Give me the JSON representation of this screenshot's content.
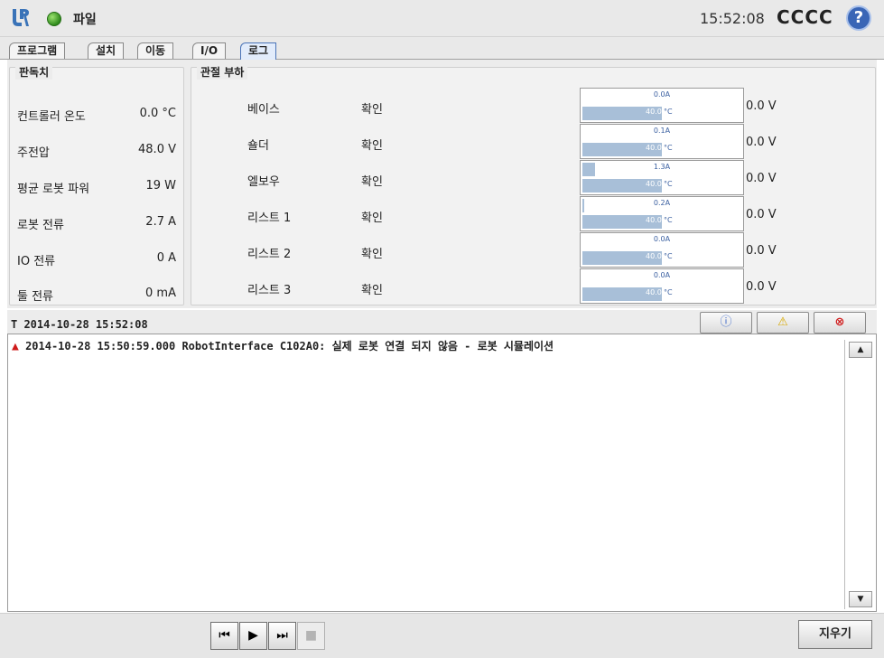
{
  "header": {
    "app_title": "파일",
    "clock": "15:52:08",
    "robot_name": "CCCC",
    "help_label": "?"
  },
  "tabs": [
    {
      "label": "프로그램"
    },
    {
      "label": "설치"
    },
    {
      "label": "이동"
    },
    {
      "label": "I/O"
    },
    {
      "label": "로그",
      "active": true
    }
  ],
  "readings": {
    "title": "판독치",
    "rows": [
      {
        "label": "컨트롤러 온도",
        "value": "0.0 °C"
      },
      {
        "label": "주전압",
        "value": "48.0  V"
      },
      {
        "label": "평균 로봇 파워",
        "value": "19  W"
      },
      {
        "label": "로봇 전류",
        "value": "2.7  A"
      },
      {
        "label": "IO 전류",
        "value": "0  A"
      },
      {
        "label": "툴 전류",
        "value": "0 mA"
      }
    ]
  },
  "joints": {
    "title": "관절 부하",
    "rows": [
      {
        "name": "베이스",
        "status": "확인",
        "current": "0.0A",
        "current_frac": 0.0,
        "temp": "40.0",
        "temp_unit": "°C",
        "voltage": "0.0 V"
      },
      {
        "name": "숄더",
        "status": "확인",
        "current": "0.1A",
        "current_frac": 0.0,
        "temp": "40.0",
        "temp_unit": "°C",
        "voltage": "0.0 V"
      },
      {
        "name": "엘보우",
        "status": "확인",
        "current": "1.3A",
        "current_frac": 0.08,
        "temp": "40.0",
        "temp_unit": "°C",
        "voltage": "0.0 V"
      },
      {
        "name": "리스트 1",
        "status": "확인",
        "current": "0.2A",
        "current_frac": 0.01,
        "temp": "40.0",
        "temp_unit": "°C",
        "voltage": "0.0 V"
      },
      {
        "name": "리스트 2",
        "status": "확인",
        "current": "0.0A",
        "current_frac": 0.0,
        "temp": "40.0",
        "temp_unit": "°C",
        "voltage": "0.0 V"
      },
      {
        "name": "리스트 3",
        "status": "확인",
        "current": "0.0A",
        "current_frac": 0.0,
        "temp": "40.0",
        "temp_unit": "°C",
        "voltage": "0.0 V"
      }
    ],
    "temp_fill_frac": 0.5
  },
  "log": {
    "timestamp": "T 2014-10-28 15:52:08",
    "filters": [
      {
        "icon": "info-icon",
        "glyph": "ⓘ",
        "color": "#3a66c8"
      },
      {
        "icon": "warning-icon",
        "glyph": "⚠",
        "color": "#d7a800"
      },
      {
        "icon": "error-icon",
        "glyph": "⊗",
        "color": "#d01f1f"
      }
    ],
    "entries": [
      {
        "icon": "warning-icon",
        "text": "2014-10-28 15:50:59.000 RobotInterface C102A0: 실제 로봇 연결 되지 않음 - 로봇 시뮬레이션"
      }
    ]
  },
  "playback": {
    "rewind_glyph": "⏮",
    "play_glyph": "▶",
    "step_glyph": "⏭",
    "stop_glyph": "■"
  },
  "clear_button": "지우기"
}
